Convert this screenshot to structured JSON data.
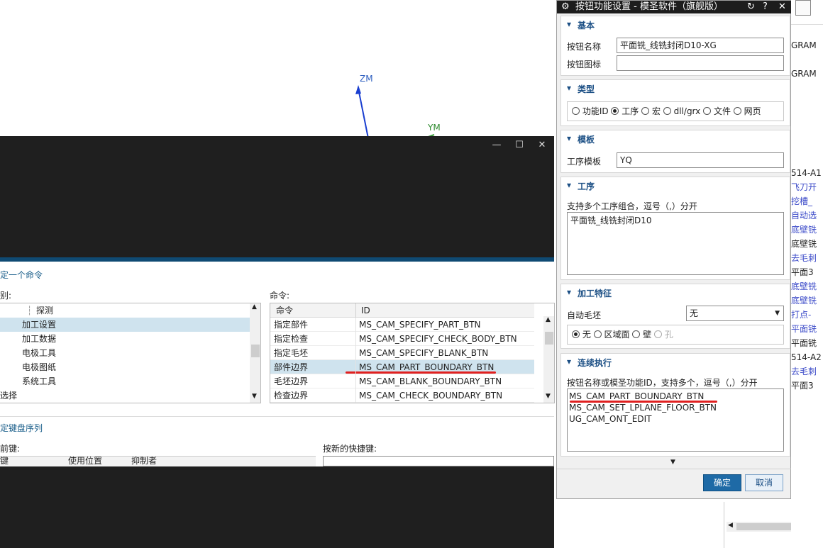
{
  "viewport": {
    "axis_z": "ZM",
    "axis_y": "YM"
  },
  "kbd_dialog": {
    "controls": {
      "minimize": "—",
      "maximize": "☐",
      "close": "✕"
    },
    "section_specify_command": "定一个命令",
    "category_label": "别:",
    "command_label": "命令:",
    "tree_items": [
      "探测",
      "加工设置",
      "加工数据",
      "电极工具",
      "电极图纸",
      "系统工具",
      "选择"
    ],
    "table_headers": {
      "command": "命令",
      "id": "ID"
    },
    "table_rows": [
      {
        "command": "指定部件",
        "id": "MS_CAM_SPECIFY_PART_BTN"
      },
      {
        "command": "指定检查",
        "id": "MS_CAM_SPECIFY_CHECK_BODY_BTN"
      },
      {
        "command": "指定毛坯",
        "id": "MS_CAM_SPECIFY_BLANK_BTN"
      },
      {
        "command": "部件边界",
        "id": "MS_CAM_PART_BOUNDARY_BTN"
      },
      {
        "command": "毛坯边界",
        "id": "MS_CAM_BLANK_BOUNDARY_BTN"
      },
      {
        "command": "检查边界",
        "id": "MS_CAM_CHECK_BOUNDARY_BTN"
      }
    ],
    "section_key_sequence": "定键盘序列",
    "current_keys_label": "前键:",
    "new_shortcut_label": "按新的快捷键:",
    "key_table_headers": {
      "key": "键",
      "used_in": "使用位置",
      "owner": "抑制者"
    }
  },
  "settings_dialog": {
    "title": "按钮功能设置 - 模圣软件（旗舰版）",
    "title_icons": {
      "reset": "↻",
      "help": "?",
      "close": "✕"
    },
    "basic": {
      "header": "基本",
      "name_label": "按钮名称",
      "name_value": "平面铣_线铣封闭D10-XG",
      "icon_label": "按钮图标",
      "icon_value": ""
    },
    "type": {
      "header": "类型",
      "options": [
        "功能ID",
        "工序",
        "宏",
        "dll/grx",
        "文件",
        "网页"
      ],
      "selected": "工序"
    },
    "template": {
      "header": "模板",
      "label": "工序模板",
      "value": "YQ"
    },
    "operation": {
      "header": "工序",
      "hint": "支持多个工序组合，逗号（,）分开",
      "value": "平面铣_线铣封闭D10"
    },
    "feature": {
      "header": "加工特征",
      "auto_blank_label": "自动毛坯",
      "auto_blank_value": "无",
      "options": [
        "无",
        "区域面",
        "壁",
        "孔"
      ],
      "selected": "无"
    },
    "sequence": {
      "header": "连续执行",
      "hint": "按钮名称或模圣功能ID，支持多个，逗号（,）分开",
      "lines": [
        "MS_CAM_PART_BOUNDARY_BTN",
        "MS_CAM_SET_LPLANE_FLOOR_BTN",
        "UG_CAM_ONT_EDIT"
      ]
    },
    "ok_label": "确定",
    "cancel_label": "取消"
  },
  "right_strip": {
    "items": [
      "GRAM",
      "GRAM",
      "514-A1",
      "飞刀开",
      "挖槽_",
      "自动选",
      "底壁铣",
      "底壁铣",
      "去毛刺",
      "平面3",
      "底壁铣",
      "底壁铣",
      "打点-",
      "平面铣",
      "平面铣",
      "514-A2",
      "去毛刺",
      "平面3"
    ]
  },
  "colors": {
    "accent_blue": "#1e6aa6",
    "header_blue": "#1a4e84",
    "dark_bg": "#1f1f1f",
    "selection": "#cfe3ee",
    "annotation_red": "#e02020"
  }
}
